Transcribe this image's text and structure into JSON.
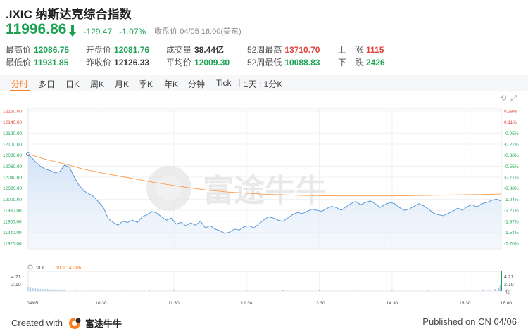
{
  "header": {
    "title": ".IXIC 纳斯达克综合指数",
    "price": "11996.86",
    "change": "-129.47",
    "change_pct": "-1.07%",
    "status": "收盘价 04/05 16:00(美东)",
    "colors": {
      "down": "#1aa251",
      "up": "#e0453c",
      "accent": "#ff7e1b"
    }
  },
  "stats": {
    "high_label": "最高价",
    "high": "12086.75",
    "low_label": "最低价",
    "low": "11931.85",
    "open_label": "开盘价",
    "open": "12081.76",
    "prev_close_label": "昨收价",
    "prev_close": "12126.33",
    "volume_label": "成交量",
    "volume": "38.44亿",
    "avg_label": "平均价",
    "avg": "12009.30",
    "w52_high_label": "52周最高",
    "w52_high": "13710.70",
    "w52_low_label": "52周最低",
    "w52_low": "10088.83",
    "up_label": "上　涨",
    "up_count": "1115",
    "down_label": "下　跌",
    "down_count": "2426"
  },
  "tabs": {
    "t1": "分时",
    "t2": "多日",
    "t3": "日K",
    "t4": "周K",
    "t5": "月K",
    "t6": "季K",
    "t7": "年K",
    "t8": "分钟",
    "t9": "Tick",
    "t10": "1天 : 1分K",
    "active": "分时"
  },
  "watermark": "富途牛牛",
  "volume_panel": {
    "vol_label": "VOL",
    "vol_value": "VOL: 4.206",
    "axis_top": "4.21",
    "axis_mid": "2.10",
    "axis_unit": "亿"
  },
  "footer": {
    "created": "Created with",
    "brand": "富途牛牛",
    "published": "Published on CN 04/06"
  },
  "chart_data": {
    "type": "line",
    "prev_close": 12126.33,
    "ylim": [
      11910,
      12165
    ],
    "y_ticks": [
      "12160.00",
      "12140.00",
      "12120.00",
      "12100.00",
      "12080.00",
      "12060.00",
      "12040.00",
      "12020.00",
      "12000.00",
      "11980.00",
      "11960.00",
      "11940.00",
      "11920.00"
    ],
    "pct_ticks": [
      "0.28%",
      "0.11%",
      "-0.05%",
      "-0.22%",
      "-0.38%",
      "-0.55%",
      "-0.71%",
      "-0.88%",
      "-1.04%",
      "-1.21%",
      "-1.37%",
      "-1.54%",
      "-1.70%"
    ],
    "x_ticks": [
      "04/05",
      "10:30",
      "11:30",
      "12:30",
      "13:30",
      "14:30",
      "15:30",
      "16:00"
    ],
    "x_tick_minutes": [
      0,
      60,
      120,
      180,
      240,
      300,
      360,
      390
    ],
    "series": [
      {
        "x": [
          0,
          3,
          6,
          10,
          14,
          18,
          22,
          26,
          30,
          34,
          38,
          42,
          46,
          50,
          54,
          58,
          62,
          66,
          70,
          74,
          78,
          82,
          86,
          90,
          94,
          98,
          102,
          106,
          110,
          114,
          118,
          122,
          126,
          130,
          134,
          138,
          142,
          146,
          150,
          154,
          158,
          162,
          166,
          170,
          174,
          178,
          182,
          186,
          190,
          194,
          198,
          202,
          206,
          210,
          214,
          218,
          222,
          226,
          230,
          234,
          238,
          242,
          246,
          250,
          254,
          258,
          262,
          266,
          270,
          274,
          278,
          282,
          286,
          290,
          294,
          298,
          302,
          306,
          310,
          314,
          318,
          322,
          326,
          330,
          334,
          338,
          342,
          346,
          350,
          354,
          358,
          362,
          366,
          370,
          374,
          378,
          382,
          386,
          390
        ],
        "y": [
          12082,
          12075,
          12068,
          12060,
          12055,
          12052,
          12048,
          12050,
          12062,
          12058,
          12040,
          12025,
          12015,
          12010,
          12005,
          11995,
          11985,
          11965,
          11958,
          11953,
          11960,
          11958,
          11962,
          11958,
          11968,
          11972,
          11978,
          11975,
          11968,
          11962,
          11966,
          11955,
          11958,
          11952,
          11957,
          11953,
          11960,
          11948,
          11952,
          11946,
          11943,
          11938,
          11940,
          11946,
          11944,
          11950,
          11952,
          11948,
          11955,
          11962,
          11968,
          11966,
          11962,
          11960,
          11966,
          11972,
          11976,
          11974,
          11978,
          11982,
          11980,
          11978,
          11983,
          11987,
          11985,
          11980,
          11986,
          11992,
          11996,
          11990,
          11994,
          11997,
          11992,
          11985,
          11990,
          11994,
          11992,
          11985,
          11980,
          11982,
          11987,
          11992,
          11988,
          11982,
          11975,
          11972,
          11970,
          11974,
          11978,
          11984,
          11980,
          11987,
          11990,
          11986,
          11992,
          11994,
          11998,
          12000,
          11996.86
        ]
      },
      {
        "x": [
          0,
          15,
          30,
          45,
          60,
          75,
          90,
          105,
          120,
          135,
          150,
          165,
          180,
          195,
          210,
          225,
          240,
          255,
          270,
          285,
          300,
          315,
          330,
          345,
          360,
          375,
          390
        ],
        "y": [
          12082,
          12072,
          12064,
          12055,
          12048,
          12042,
          12036,
          12030,
          12025,
          12020,
          12016,
          12013,
          12011,
          12009,
          12008,
          12007,
          12006.5,
          12006,
          12006,
          12006,
          12006,
          12006.5,
          12007,
          12007.5,
          12008,
          12008.5,
          12009.3
        ]
      }
    ],
    "volume": {
      "ylim": [
        0,
        4.21
      ],
      "x": [
        0,
        2,
        4,
        6,
        8,
        10,
        12,
        14,
        16,
        18,
        20,
        22,
        24,
        26,
        28,
        30,
        40,
        50,
        60,
        80,
        100,
        120,
        150,
        180,
        210,
        240,
        270,
        300,
        330,
        360,
        370,
        375,
        380,
        385,
        388,
        389,
        390
      ],
      "y": [
        0.9,
        0.7,
        0.6,
        0.55,
        0.5,
        0.45,
        0.42,
        0.4,
        0.38,
        0.36,
        0.35,
        0.34,
        0.33,
        0.32,
        0.31,
        0.3,
        0.28,
        0.26,
        0.25,
        0.24,
        0.23,
        0.22,
        0.2,
        0.19,
        0.2,
        0.21,
        0.22,
        0.23,
        0.24,
        0.27,
        0.3,
        0.33,
        0.38,
        0.45,
        0.6,
        1.2,
        4.206
      ]
    }
  }
}
